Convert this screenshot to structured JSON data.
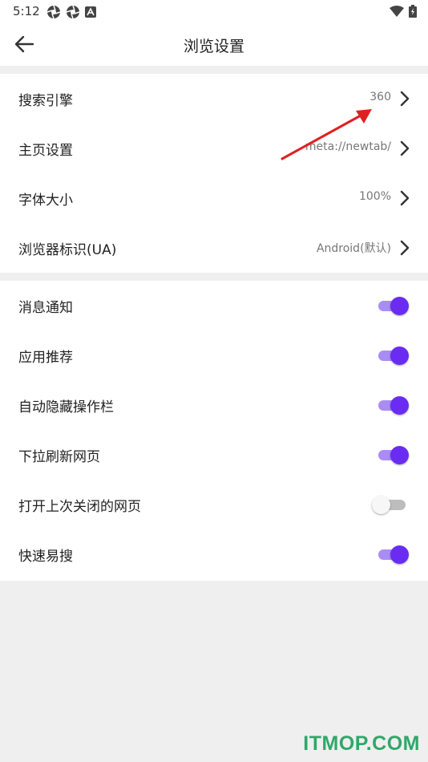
{
  "status_bar": {
    "time": "5:12"
  },
  "app_bar": {
    "title": "浏览设置"
  },
  "settings_group1": [
    {
      "label": "搜索引擎",
      "value": "360"
    },
    {
      "label": "主页设置",
      "value": "meta://newtab/"
    },
    {
      "label": "字体大小",
      "value": "100%"
    },
    {
      "label": "浏览器标识(UA)",
      "value": "Android(默认)"
    }
  ],
  "settings_group2": [
    {
      "label": "消息通知",
      "enabled": true
    },
    {
      "label": "应用推荐",
      "enabled": true
    },
    {
      "label": "自动隐藏操作栏",
      "enabled": true
    },
    {
      "label": "下拉刷新网页",
      "enabled": true
    },
    {
      "label": "打开上次关闭的网页",
      "enabled": false
    },
    {
      "label": "快速易搜",
      "enabled": true
    }
  ],
  "watermark": "ITMOP.COM",
  "colors": {
    "toggle_on": "#6a2cf2",
    "toggle_track_on": "#a98df5",
    "annotation_arrow": "#e02020",
    "watermark": "#2fa86a"
  }
}
